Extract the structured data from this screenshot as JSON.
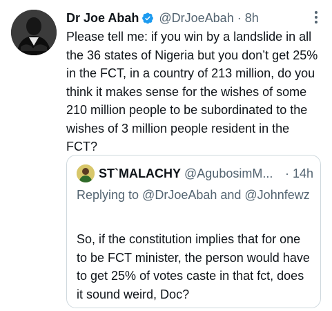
{
  "tweet": {
    "author_name": "Dr Joe Abah",
    "handle": "@DrJoeAbah",
    "separator": "·",
    "time": "8h",
    "text": "Please tell me: if you win by a landslide in all the 36 states of Nigeria but you don’t get 25% in the FCT, in a country of 213 million, do you think it makes sense for the wishes of some 210 million people to be subordinated to the wishes of 3 million people resident in the FCT?"
  },
  "quoted": {
    "author_name": "ST`MALACHY",
    "handle": "@AgubosimM...",
    "separator": "·",
    "time": "14h",
    "replying_to": "Replying to @DrJoeAbah and @Johnfewz",
    "text": "So, if the constitution implies that for one to be FCT minister, the person would have to get 25% of votes caste in that fct, does it sound weird, Doc?"
  },
  "colors": {
    "verified_badge": "#1d9bf0",
    "secondary_text": "#536471",
    "border": "#cfd9de"
  },
  "icons": {
    "verified": "verified-badge-icon",
    "more": "more-options-icon"
  }
}
